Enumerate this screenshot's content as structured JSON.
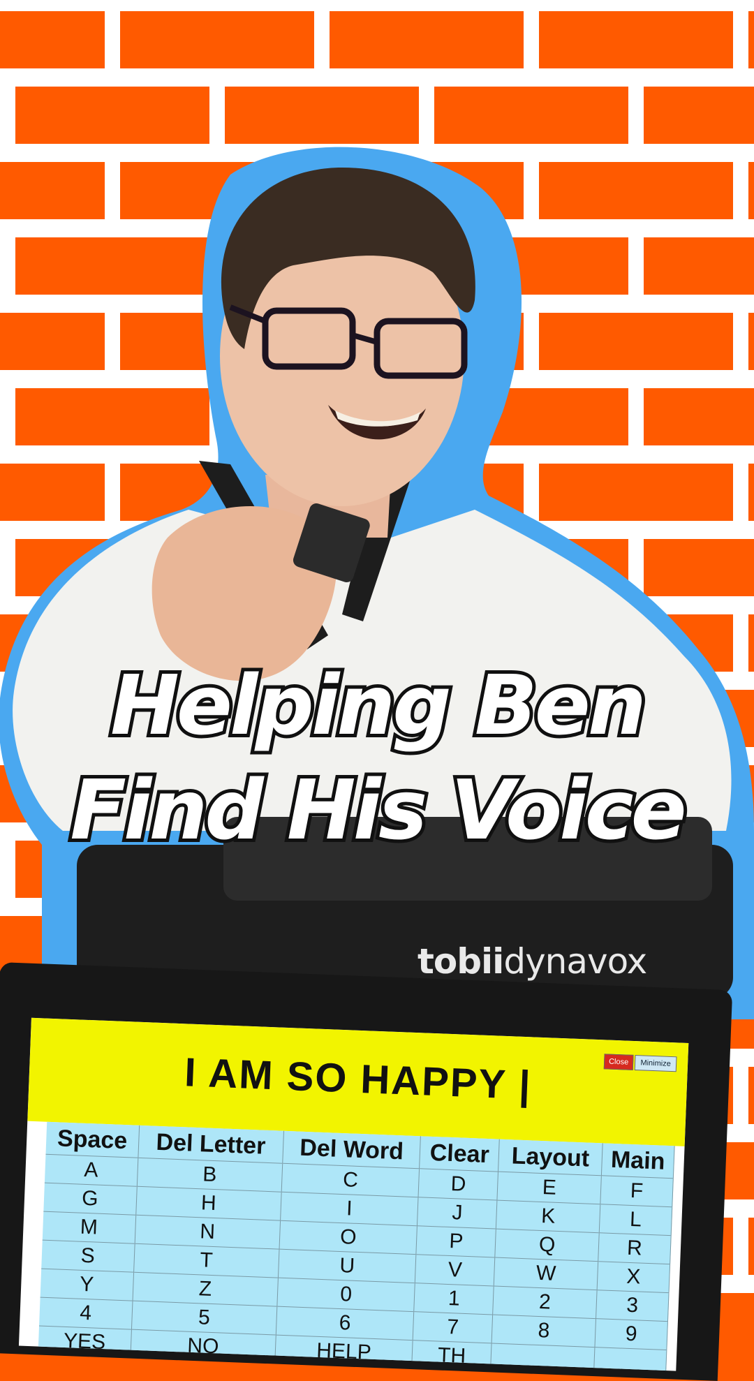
{
  "headline": {
    "line1": "Helping Ben",
    "line2": "Find His Voice"
  },
  "device": {
    "brand_bold": "tobii",
    "brand_light": "dynavox"
  },
  "window": {
    "close_label": "Close",
    "minimize_label": "Minimize"
  },
  "message": {
    "text": "I AM SO HAPPY |"
  },
  "keyboard": {
    "headers": [
      "Space",
      "Del Letter",
      "Del Word",
      "Clear",
      "Layout",
      "Main"
    ],
    "rows": [
      [
        "A",
        "B",
        "C",
        "D",
        "E",
        "F"
      ],
      [
        "G",
        "H",
        "I",
        "J",
        "K",
        "L"
      ],
      [
        "M",
        "N",
        "O",
        "P",
        "Q",
        "R"
      ],
      [
        "S",
        "T",
        "U",
        "V",
        "W",
        "X"
      ],
      [
        "Y",
        "Z",
        "0",
        "1",
        "2",
        "3"
      ],
      [
        "4",
        "5",
        "6",
        "7",
        "8",
        "9"
      ],
      [
        "YES",
        "NO",
        "HELP",
        "TH",
        "",
        ""
      ]
    ]
  },
  "colors": {
    "brick": "#ff5a00",
    "mortar": "#ffffff",
    "outline": "#4aa8f0",
    "message_bar": "#f2f400",
    "keys": "#aee6f8"
  },
  "icons": {
    "close": "close-button",
    "minimize": "minimize-button"
  }
}
